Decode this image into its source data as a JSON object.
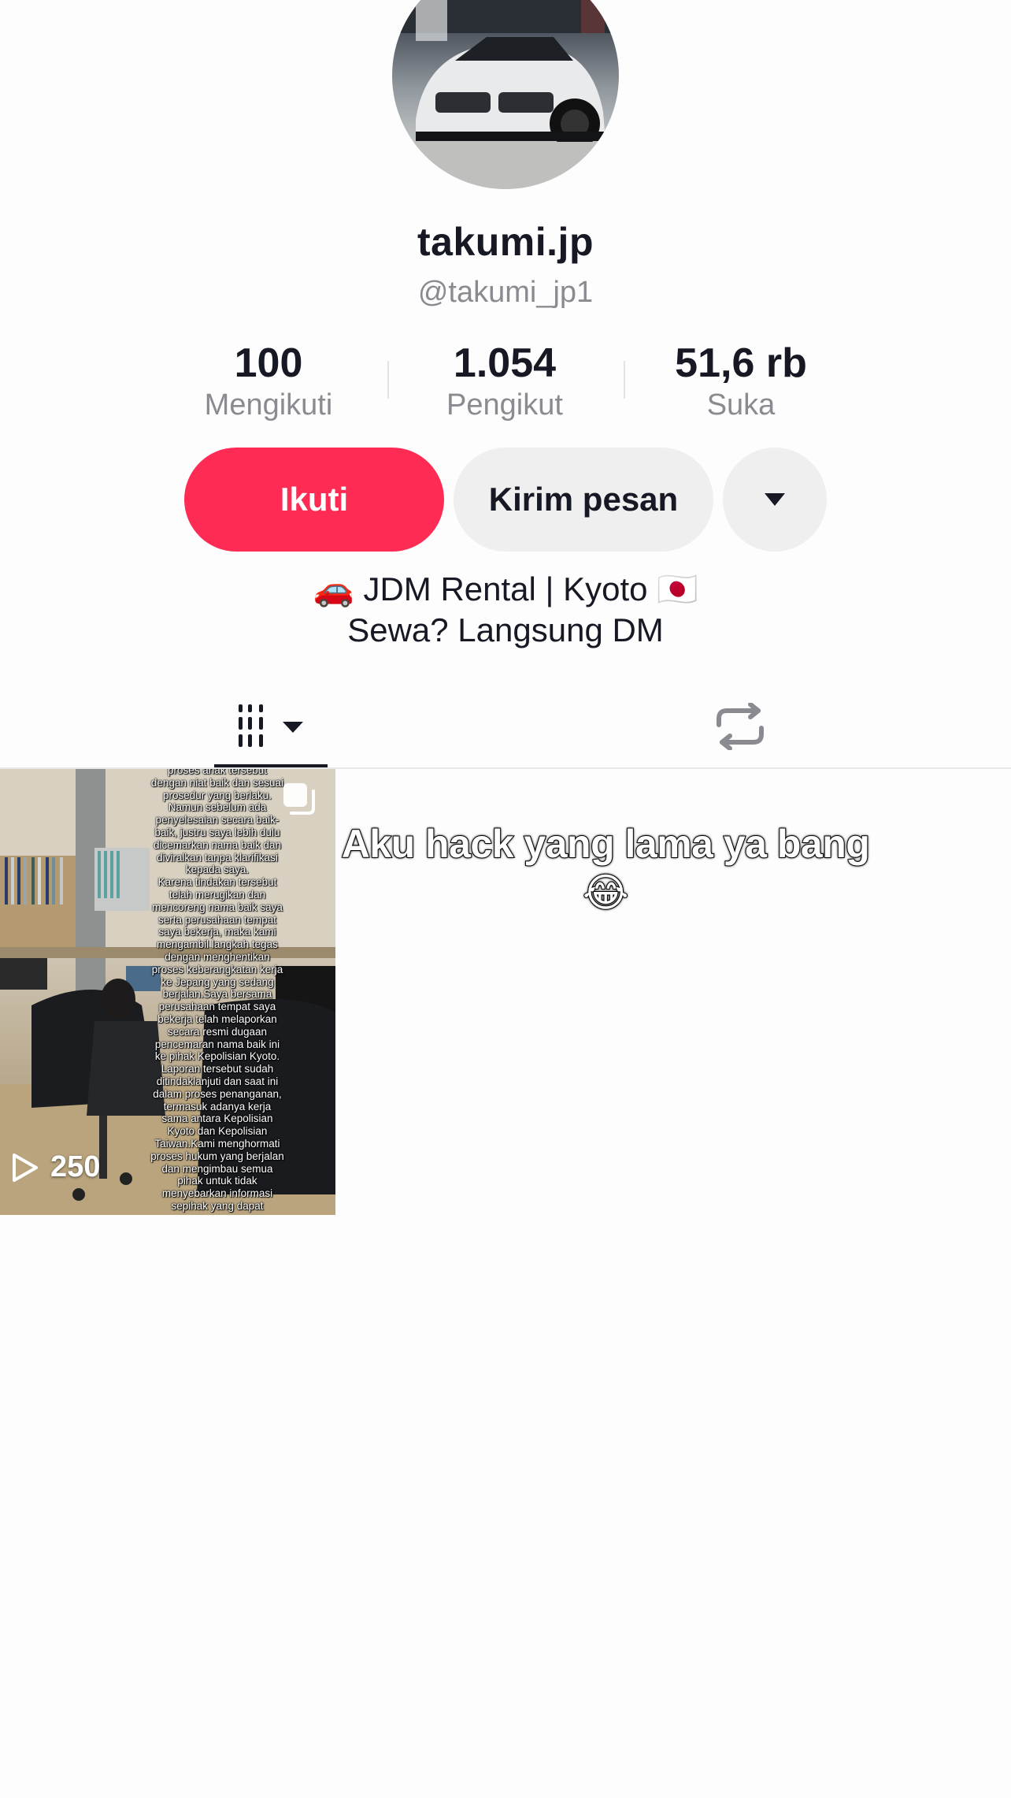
{
  "profile": {
    "display_name": "takumi.jp",
    "username": "@takumi_jp1",
    "stats": [
      {
        "value": "100",
        "label": "Mengikuti"
      },
      {
        "value": "1.054",
        "label": "Pengikut"
      },
      {
        "value": "51,6 rb",
        "label": "Suka"
      }
    ],
    "bio_line1": "🚗 JDM Rental | Kyoto 🇯🇵",
    "bio_line2": "Sewa? Langsung DM"
  },
  "actions": {
    "follow_label": "Ikuti",
    "message_label": "Kirim pesan",
    "more_icon": "caret-down-icon"
  },
  "tabs": {
    "videos_icon": "grid-icon",
    "repost_icon": "repost-icon",
    "active": "videos"
  },
  "videos": [
    {
      "caption": "proses anak tersebut\ndengan niat baik dan sesuai\nprosedur yang berlaku.\nNamun sebelum ada\npenyelesaian secara baik-\nbaik, justru saya lebih dulu\ndicemarkan nama baik dan\ndiviralkan tanpa klarifikasi\nkepada saya.\nKarena tindakan tersebut\ntelah merugikan dan\nmencoreng nama baik saya\nserta perusahaan tempat\nsaya bekerja, maka kami\nmengambil langkah tegas\ndengan menghentikan\nproses keberangkatan kerja\nke Jepang yang sedang\nberjalan.Saya bersama\nperusahaan tempat saya\nbekerja telah melaporkan\nsecara resmi dugaan\npencemaran nama baik ini\nke pihak Kepolisian Kyoto.\nLaporan tersebut sudah\nditindaklanjuti dan saat ini\ndalam proses penanganan,\ntermasuk adanya kerja\nsama antara Kepolisian\nKyoto dan Kepolisian\nTaiwan.Kami menghormati\nproses hukum yang berjalan\ndan mengimbau semua\npihak untuk tidak\nmenyebarkan informasi\nsepihak yang dapat",
      "play_count": "250",
      "type_icon": "multi-photo-icon"
    }
  ],
  "overlay_text": "Aku hack yang lama ya bang\n😂",
  "colors": {
    "accent": "#fe2c55",
    "secondary_button": "#efefef",
    "muted_text": "#8a8b91"
  }
}
